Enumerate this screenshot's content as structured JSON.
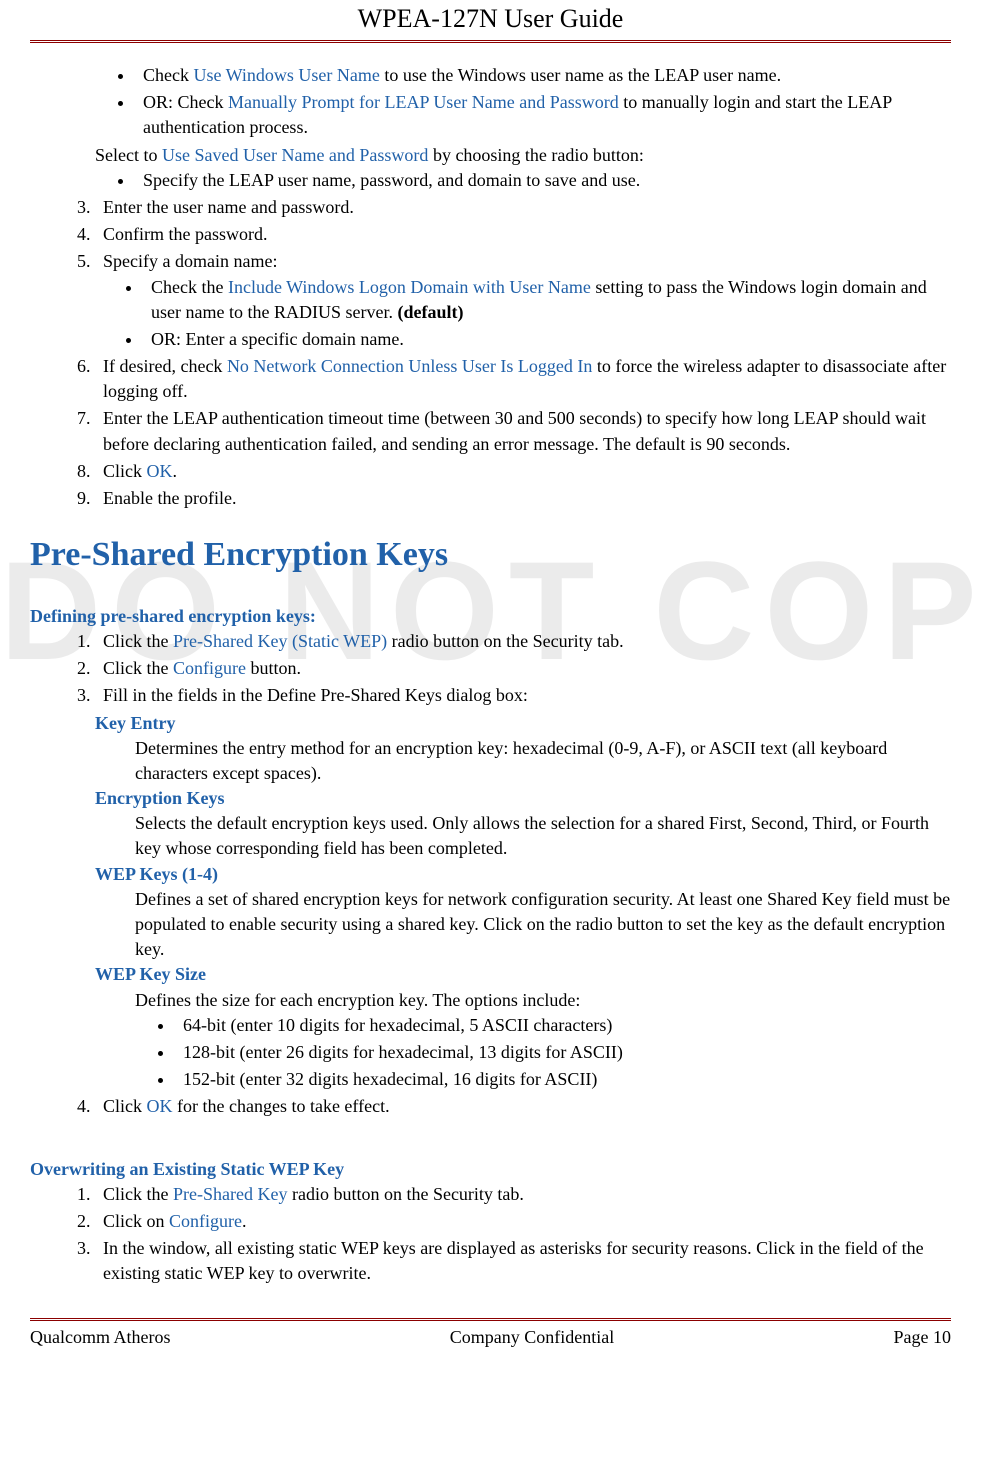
{
  "header": {
    "title": "WPEA-127N User Guide"
  },
  "footer": {
    "left": "Qualcomm Atheros",
    "center": "Company Confidential",
    "right": "Page 10"
  },
  "watermark": "DO NOT COPY",
  "top_bullets": {
    "b1_pre": "Check ",
    "b1_link": "Use Windows User Name",
    "b1_post": " to use the Windows user name as the LEAP user name.",
    "b2_pre": "OR: Check ",
    "b2_link": "Manually Prompt for LEAP User Name and Password",
    "b2_post": " to manually login and start the LEAP authentication process."
  },
  "select_line": {
    "pre": "Select to ",
    "link": "Use Saved User Name and Password",
    "post": " by choosing the radio button:",
    "sub_bullet": "Specify the LEAP user name, password, and domain to save and use."
  },
  "steps": {
    "s3": "Enter the user name and password.",
    "s4": "Confirm the password.",
    "s5": "Specify a domain name:",
    "s5_b1_pre": "Check the ",
    "s5_b1_link": "Include Windows Logon Domain with User Name",
    "s5_b1_post": " setting to pass the Windows login domain and user name to the RADIUS server. ",
    "s5_b1_bold": "(default)",
    "s5_b2": "OR: Enter a specific domain name.",
    "s6_pre": "If desired, check ",
    "s6_link": "No Network Connection Unless User Is Logged In",
    "s6_post": " to force the wireless adapter to disassociate after logging off.",
    "s7": "Enter the LEAP authentication timeout time (between 30 and 500 seconds) to specify how long LEAP should wait before declaring authentication failed, and sending an error message. The default is 90 seconds.",
    "s8_pre": "Click ",
    "s8_link": "OK",
    "s8_post": ".",
    "s9": "Enable the profile."
  },
  "section2": {
    "title": "Pre-Shared Encryption Keys",
    "sub1": "Defining pre-shared encryption keys:",
    "d1_pre": "Click the ",
    "d1_link": "Pre-Shared Key (Static WEP)",
    "d1_post": " radio button on the Security tab.",
    "d2_pre": "Click the ",
    "d2_link": "Configure",
    "d2_post": " button.",
    "d3": "Fill in the fields in the Define Pre-Shared Keys dialog box:",
    "term1": "Key Entry",
    "def1": "Determines the entry method for an encryption key: hexadecimal (0-9, A-F), or ASCII text (all keyboard characters except spaces).",
    "term2": "Encryption Keys",
    "def2": "Selects the default encryption keys used. Only allows the selection for a shared First, Second, Third, or Fourth key whose corresponding field has been completed.",
    "term3": "WEP Keys (1-4)",
    "def3": "Defines a set of shared encryption keys for network configuration security. At least one Shared Key field must be populated to enable security using a shared key. Click on the radio button to set the key as the default encryption key.",
    "term4": "WEP Key Size",
    "def4": "Defines the size for each encryption key. The options include:",
    "def4_b1": "64-bit (enter 10 digits for hexadecimal, 5 ASCII characters)",
    "def4_b2": "128-bit (enter 26 digits for hexadecimal, 13 digits for ASCII)",
    "def4_b3": "152-bit (enter 32 digits hexadecimal, 16 digits for ASCII)",
    "d4_pre": "Click ",
    "d4_link": "OK",
    "d4_post": " for the changes to take effect.",
    "sub2": "Overwriting an Existing Static WEP Key",
    "o1_pre": "Click the ",
    "o1_link": "Pre-Shared Key",
    "o1_post": " radio button on the Security tab.",
    "o2_pre": "Click on ",
    "o2_link": "Configure",
    "o2_post": ".",
    "o3": "In the window, all existing static WEP keys are displayed as asterisks for security reasons. Click in the field of the existing static WEP key to overwrite."
  }
}
